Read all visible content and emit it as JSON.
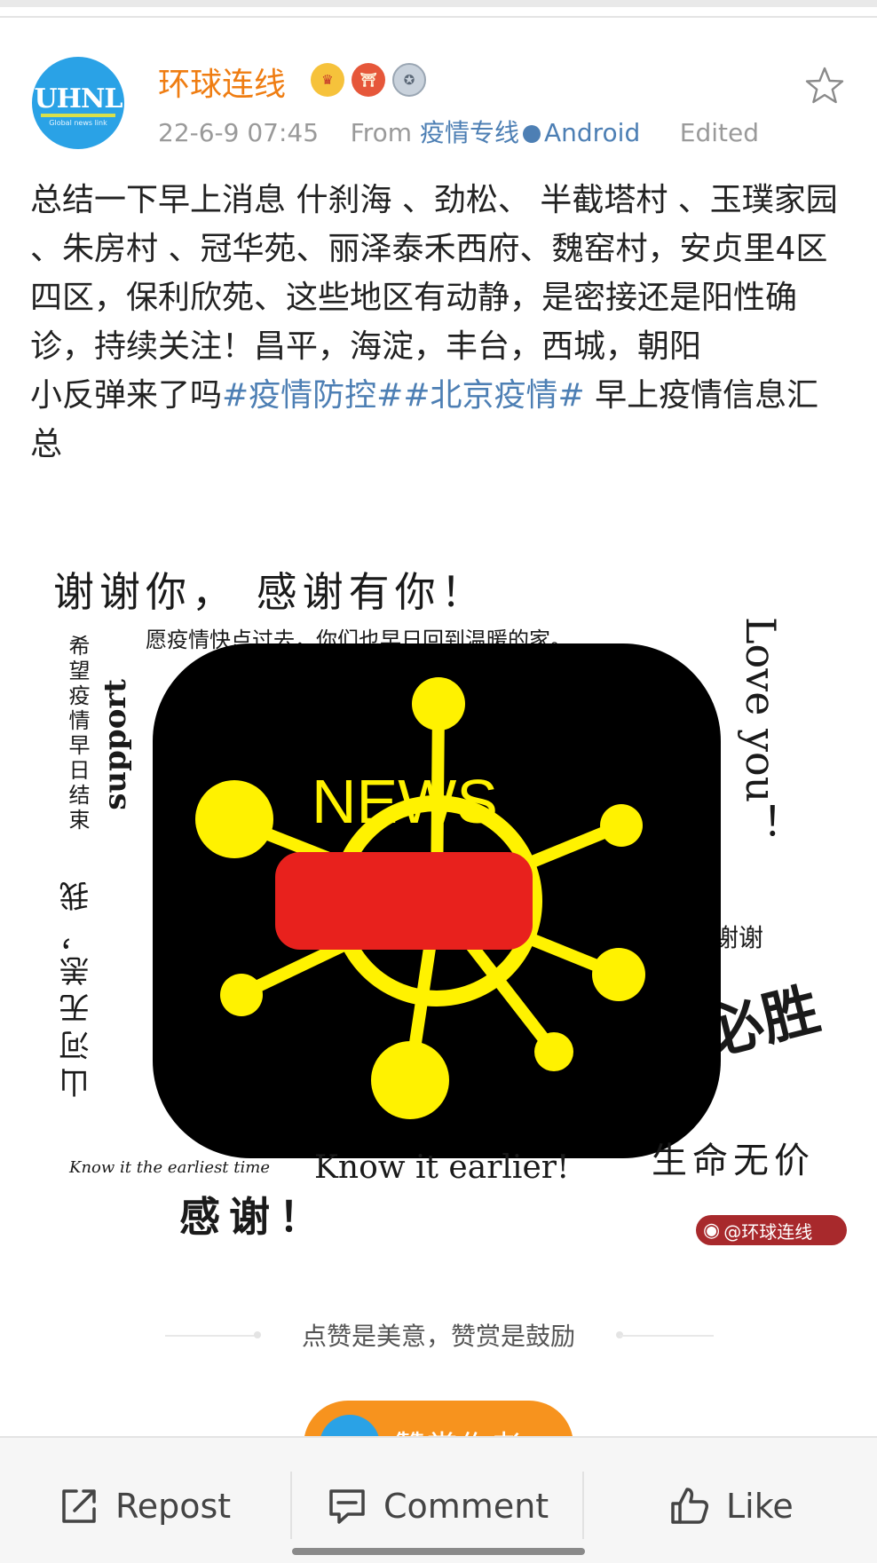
{
  "post": {
    "username": "环球连线",
    "avatar_logo": "UHNL",
    "avatar_tagline": "Global news link",
    "badges": [
      "crown-badge",
      "torii-badge",
      "medal-badge"
    ],
    "date": "22-6-9 07:45",
    "from_label": "From",
    "source": "疫情专线",
    "client": "Android",
    "edited": "Edited",
    "text_main": "总结一下早上消息 什刹海 、劲松、  半截塔村 、玉璞家园 、朱房村 、冠华苑、丽泽泰禾西府、魏窑村，安贞里4区四区，保利欣苑、这些地区有动静，是密接还是阳性确诊，持续关注！昌平，海淀，丰台，西城，朝阳",
    "text_second_prefix": "小反弹来了吗",
    "hashtag1": "#疫情防控#",
    "hashtag2": "#北京疫情#",
    "text_second_suffix": " 早上疫情信息汇总"
  },
  "image": {
    "center_label": "NEWS",
    "handwriting": {
      "top": "谢谢你，  感谢有你！",
      "top_small": "愿疫情快点过去，你们也早日回到温暖的家。",
      "left_cn": "希望疫情早日结束",
      "left_support": "support",
      "left_bottom": "山河无恙，我",
      "right_love": "Love you！",
      "right_thanks": "谢谢",
      "right_win": "必胜",
      "bottom_small": "Know it the earliest time",
      "bottom_en": "Know it earlier!",
      "bottom_right": "生命无价",
      "bottom_thanks": "感谢！"
    },
    "watermark": "@环球连线"
  },
  "reward": {
    "divider_text": "点赞是美意，赞赏是鼓励",
    "button_label": "赞赏作者",
    "button_avatar": "UHNL"
  },
  "actions": {
    "repost": "Repost",
    "comment": "Comment",
    "like": "Like"
  },
  "colors": {
    "username": "#ef7d12",
    "link": "#4d7fb4",
    "reward": "#f7931e",
    "news_red": "#e8211d",
    "news_yellow": "#fff200"
  }
}
